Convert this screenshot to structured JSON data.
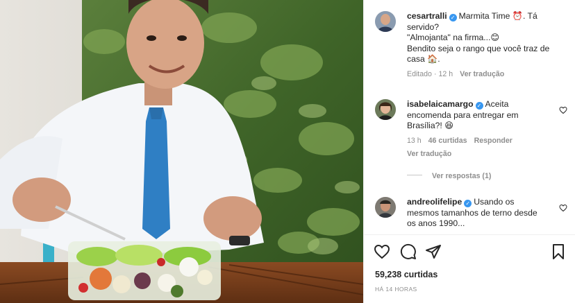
{
  "post": {
    "author": "cesartralli",
    "caption_lines": [
      "Marmita Time ⏰. Tá",
      "servido?",
      "\"Almojanta\" na firma...😊",
      "Bendito seja o rango que você traz de",
      "casa 🏠."
    ],
    "edited_label": "Editado",
    "time": "12 h",
    "translate_label": "Ver tradução"
  },
  "comments": [
    {
      "user": "isabelaicamargo",
      "text_lines": [
        "Aceita",
        "encomenda para entregar em",
        "Brasília?! 😆"
      ],
      "time": "13 h",
      "likes": "46 curtidas",
      "reply_label": "Responder",
      "translate_label": "Ver tradução",
      "view_replies": "Ver respostas (1)"
    },
    {
      "user": "andreolifelipe",
      "text_lines": [
        "Usando os",
        "mesmos tamanhos de terno desde",
        "os anos 1990..."
      ]
    }
  ],
  "footer": {
    "likes": "59,238 curtidas",
    "time_ago": "HÁ 14 HORAS"
  },
  "icons": {
    "like": "heart-icon",
    "comment": "comment-icon",
    "share": "paper-plane-icon",
    "save": "bookmark-icon"
  },
  "colors": {
    "verified": "#3897f0",
    "muted": "#8e8e8e",
    "text": "#262626",
    "tie": "#2f7fc4"
  }
}
